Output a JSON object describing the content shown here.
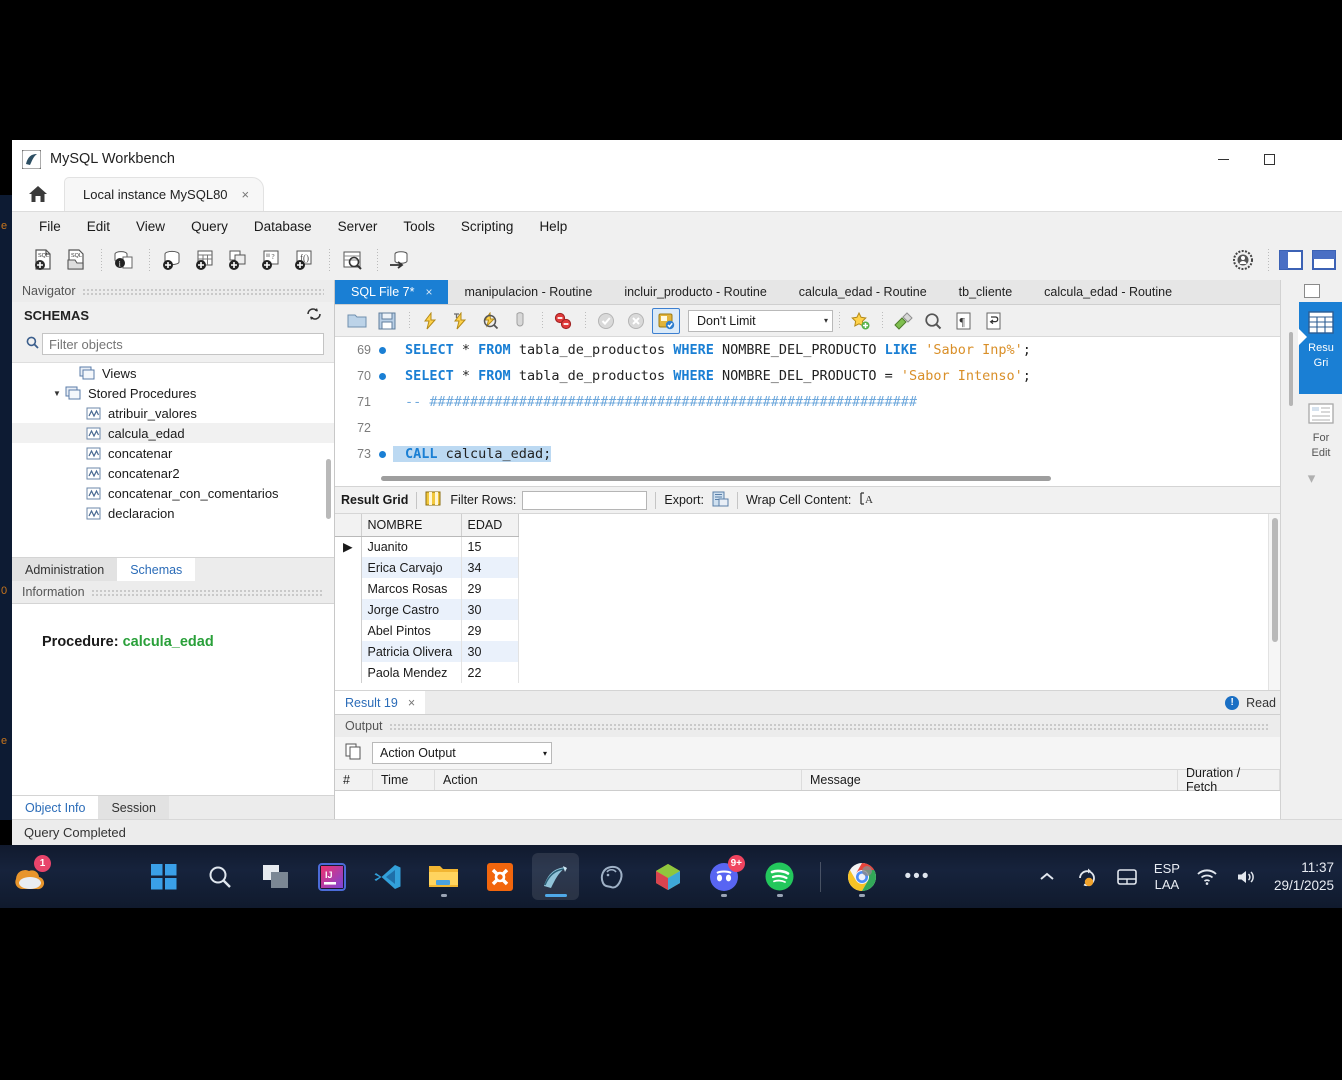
{
  "window": {
    "app_title": "MySQL Workbench",
    "minimize_label": "Minimize",
    "maximize_label": "Maximize",
    "status_text": "Query Completed"
  },
  "connection_tabs": [
    {
      "label": "Local instance MySQL80",
      "close": "×",
      "active": true
    }
  ],
  "menu": {
    "items": [
      {
        "label": "File"
      },
      {
        "label": "Edit"
      },
      {
        "label": "View"
      },
      {
        "label": "Query"
      },
      {
        "label": "Database"
      },
      {
        "label": "Server"
      },
      {
        "label": "Tools"
      },
      {
        "label": "Scripting"
      },
      {
        "label": "Help"
      }
    ]
  },
  "sidebar": {
    "navigator_title": "Navigator",
    "schemas_title": "SCHEMAS",
    "filter_placeholder": "Filter objects",
    "filter_value": "",
    "tree": [
      {
        "label": "Views",
        "indent": 2,
        "icon": "views-icon",
        "expander": "",
        "selected": false
      },
      {
        "label": "Stored Procedures",
        "indent": 1,
        "icon": "folder-icon",
        "expander": "▼",
        "selected": false
      },
      {
        "label": "atribuir_valores",
        "indent": 3,
        "icon": "routine-icon",
        "expander": "",
        "selected": false
      },
      {
        "label": "calcula_edad",
        "indent": 3,
        "icon": "routine-icon",
        "expander": "",
        "selected": true
      },
      {
        "label": "concatenar",
        "indent": 3,
        "icon": "routine-icon",
        "expander": "",
        "selected": false
      },
      {
        "label": "concatenar2",
        "indent": 3,
        "icon": "routine-icon",
        "expander": "",
        "selected": false
      },
      {
        "label": "concatenar_con_comentarios",
        "indent": 3,
        "icon": "routine-icon",
        "expander": "",
        "selected": false
      },
      {
        "label": "declaracion",
        "indent": 3,
        "icon": "routine-icon",
        "expander": "",
        "selected": false
      }
    ],
    "nav_tabs": [
      {
        "label": "Administration",
        "active": false
      },
      {
        "label": "Schemas",
        "active": true
      }
    ],
    "information_title": "Information",
    "object_info": {
      "prefix": "Procedure:",
      "name": "calcula_edad",
      "name_color": "#2aa03a"
    },
    "info_tabs": [
      {
        "label": "Object Info",
        "active": true
      },
      {
        "label": "Session",
        "active": false
      }
    ]
  },
  "editor_tabs": [
    {
      "label": "SQL File 7*",
      "close": "×",
      "active": true
    },
    {
      "label": "manipulacion - Routine",
      "active": false
    },
    {
      "label": "incluir_producto - Routine",
      "active": false
    },
    {
      "label": "calcula_edad - Routine",
      "active": false
    },
    {
      "label": "tb_cliente",
      "active": false
    },
    {
      "label": "calcula_edad - Routine",
      "active": false
    }
  ],
  "sql_toolbar": {
    "limit_value": "Don't Limit",
    "caret": "▾"
  },
  "editor": {
    "lines": [
      {
        "number": "69",
        "marker": true,
        "selected": false,
        "tokens": [
          {
            "t": "SELECT",
            "c": "kw"
          },
          {
            "t": " * ",
            "c": "plain"
          },
          {
            "t": "FROM",
            "c": "kw"
          },
          {
            "t": " tabla_de_productos ",
            "c": "plain"
          },
          {
            "t": "WHERE",
            "c": "kw"
          },
          {
            "t": " NOMBRE_DEL_PRODUCTO ",
            "c": "plain"
          },
          {
            "t": "LIKE",
            "c": "kw"
          },
          {
            "t": " ",
            "c": "plain"
          },
          {
            "t": "'Sabor Inp%'",
            "c": "str"
          },
          {
            "t": ";",
            "c": "plain"
          }
        ]
      },
      {
        "number": "70",
        "marker": true,
        "selected": false,
        "tokens": [
          {
            "t": "SELECT",
            "c": "kw"
          },
          {
            "t": " * ",
            "c": "plain"
          },
          {
            "t": "FROM",
            "c": "kw"
          },
          {
            "t": " tabla_de_productos ",
            "c": "plain"
          },
          {
            "t": "WHERE",
            "c": "kw"
          },
          {
            "t": " NOMBRE_DEL_PRODUCTO = ",
            "c": "plain"
          },
          {
            "t": "'Sabor Intenso'",
            "c": "str"
          },
          {
            "t": ";",
            "c": "plain"
          }
        ]
      },
      {
        "number": "71",
        "marker": false,
        "selected": false,
        "tokens": [
          {
            "t": "-- ############################################################",
            "c": "cmt"
          }
        ]
      },
      {
        "number": "72",
        "marker": false,
        "selected": false,
        "tokens": []
      },
      {
        "number": "73",
        "marker": true,
        "selected": true,
        "tokens": [
          {
            "t": "CALL",
            "c": "kw"
          },
          {
            "t": " calcula_edad;",
            "c": "plain"
          }
        ]
      }
    ]
  },
  "result_toolbar": {
    "result_grid_label": "Result Grid",
    "filter_rows_label": "Filter Rows:",
    "filter_rows_value": "",
    "export_label": "Export:",
    "wrap_cell_label": "Wrap Cell Content:"
  },
  "result_grid": {
    "columns": [
      "NOMBRE",
      "EDAD"
    ],
    "rows": [
      {
        "marker": "▶",
        "cells": [
          "Juanito",
          "15"
        ]
      },
      {
        "marker": "",
        "cells": [
          "Erica Carvajo",
          "34"
        ]
      },
      {
        "marker": "",
        "cells": [
          "Marcos Rosas",
          "29"
        ]
      },
      {
        "marker": "",
        "cells": [
          "Jorge Castro",
          "30"
        ]
      },
      {
        "marker": "",
        "cells": [
          "Abel Pintos",
          "29"
        ]
      },
      {
        "marker": "",
        "cells": [
          "Patricia Olivera",
          "30"
        ]
      },
      {
        "marker": "",
        "cells": [
          "Paola Mendez",
          "22"
        ]
      }
    ]
  },
  "right_panel": {
    "items": [
      {
        "label_line1": "Resu",
        "label_line2": "Gri",
        "icon": "grid-icon",
        "active": true
      },
      {
        "label_line1": "For",
        "label_line2": "Edit",
        "icon": "form-editor-icon",
        "active": false
      }
    ]
  },
  "result_tabs": {
    "tab_label": "Result 19",
    "close": "×",
    "readonly_label": "Read"
  },
  "output": {
    "panel_title": "Output",
    "selected_view": "Action Output",
    "caret": "▾",
    "columns": [
      "#",
      "Time",
      "Action",
      "Message",
      "Duration / Fetch"
    ],
    "rows": []
  },
  "taskbar": {
    "left_badge": "1",
    "apps": [
      {
        "name": "start-button",
        "running": false
      },
      {
        "name": "search-button",
        "running": false
      },
      {
        "name": "task-view-button",
        "running": false
      },
      {
        "name": "intellij-idea",
        "running": false
      },
      {
        "name": "vs-code",
        "running": false
      },
      {
        "name": "file-explorer",
        "running": true
      },
      {
        "name": "xampp",
        "running": false
      },
      {
        "name": "mysql-workbench",
        "running": true,
        "active": true
      },
      {
        "name": "postgresql",
        "running": false
      },
      {
        "name": "unity",
        "running": false
      },
      {
        "name": "discord",
        "running": true,
        "badge": "9+"
      },
      {
        "name": "spotify",
        "running": true
      },
      {
        "name": "google-chrome",
        "running": true
      }
    ],
    "overflow": "•••",
    "language_line1": "ESP",
    "language_line2": "LAA",
    "clock_time": "11:37",
    "clock_date": "29/1/2025"
  }
}
